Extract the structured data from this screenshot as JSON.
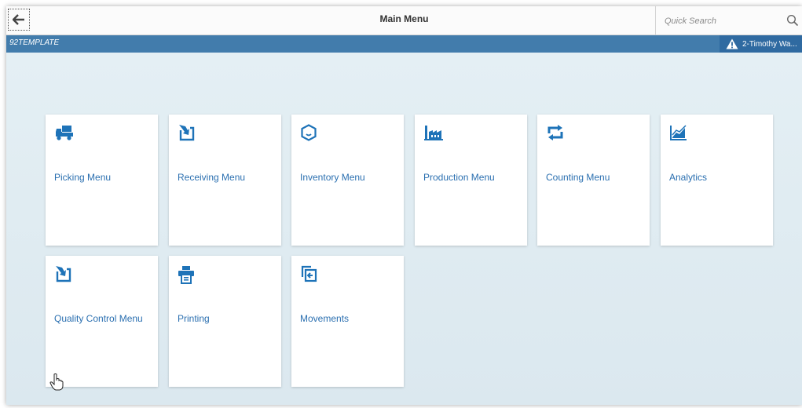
{
  "header": {
    "title": "Main Menu",
    "search_placeholder": "Quick Search"
  },
  "subheader": {
    "company": "92TEMPLATE",
    "user": "2-Timothy Wa..."
  },
  "tiles": [
    {
      "label": "Picking Menu",
      "icon": "truck-icon"
    },
    {
      "label": "Receiving Menu",
      "icon": "receive-arrow-icon"
    },
    {
      "label": "Inventory Menu",
      "icon": "box-icon"
    },
    {
      "label": "Production Menu",
      "icon": "factory-icon"
    },
    {
      "label": "Counting Menu",
      "icon": "refresh-count-icon"
    },
    {
      "label": "Analytics",
      "icon": "area-chart-icon"
    },
    {
      "label": "Quality Control Menu",
      "icon": "receive-arrow-icon"
    },
    {
      "label": "Printing",
      "icon": "printer-icon"
    },
    {
      "label": "Movements",
      "icon": "transfer-icon"
    }
  ],
  "colors": {
    "accent": "#2a6fb0",
    "subbar": "#427cac",
    "icon": "#1e73b8"
  }
}
